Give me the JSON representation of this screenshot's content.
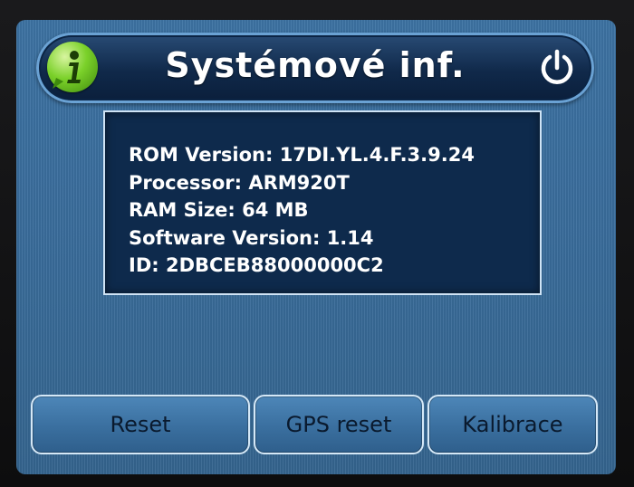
{
  "header": {
    "title": "Systémové inf.",
    "info_icon": "info-icon",
    "power_icon": "power-icon"
  },
  "info": {
    "lines": [
      "ROM Version: 17DI.YL.4.F.3.9.24",
      "Processor: ARM920T",
      "RAM Size: 64 MB",
      "Software Version: 1.14",
      "ID: 2DBCEB88000000C2"
    ]
  },
  "buttons": {
    "reset": "Reset",
    "gps_reset": "GPS reset",
    "calibrate": "Kalibrace"
  },
  "colors": {
    "screen_bg": "#3a6d9c",
    "title_bar": "#10294a",
    "panel_bg": "#0e2a4c",
    "info_icon": "#7bd12a"
  }
}
